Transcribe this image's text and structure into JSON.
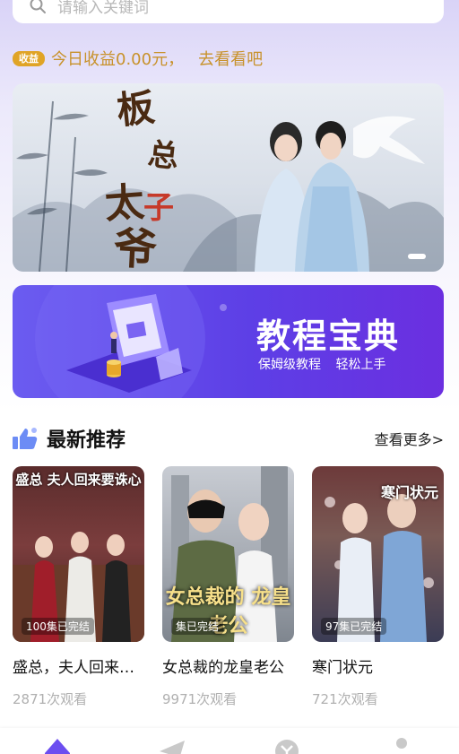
{
  "search": {
    "placeholder": "请输入关键词"
  },
  "earnings": {
    "badge": "收益",
    "text": "今日收益0.00元，",
    "link": "去看看吧"
  },
  "banner": {
    "title_art": "板总太子爷"
  },
  "tutorial": {
    "title": "教程宝典",
    "subtitle": "保姆级教程 轻松上手"
  },
  "recommend": {
    "title": "最新推荐",
    "more_label": "查看更多>",
    "items": [
      {
        "title": "盛总，夫人回来要诛心",
        "status": "100集已完结",
        "views": "2871次观看",
        "poster_text": "盛总 夫人回来要诛心"
      },
      {
        "title": "女总裁的龙皇老公",
        "status": "集已完结",
        "views": "9971次观看",
        "poster_text": "女总裁的 龙皇老公"
      },
      {
        "title": "寒门状元",
        "status": "97集已完结",
        "views": "721次观看",
        "poster_text": "寒门状元"
      }
    ]
  },
  "colors": {
    "accent": "#5d3fe6",
    "gold": "#c8922b",
    "badge": "#e0a426",
    "tab_active": "#6c4ef0"
  },
  "tabs": [
    {
      "icon": "home-icon"
    },
    {
      "icon": "paper-plane-icon"
    },
    {
      "icon": "earn-icon"
    },
    {
      "icon": "profile-icon"
    }
  ]
}
